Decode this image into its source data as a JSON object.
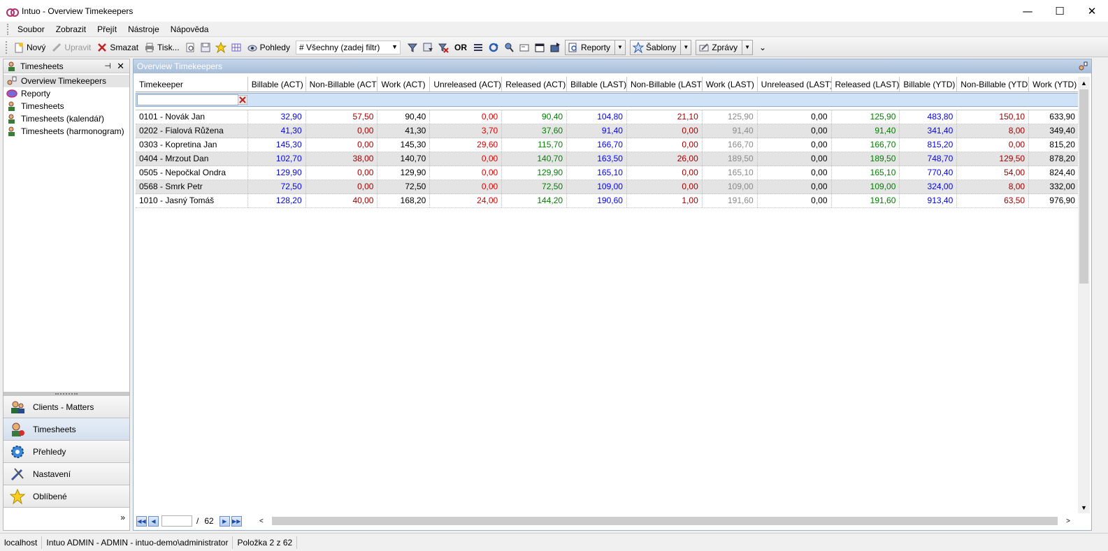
{
  "window": {
    "title": "Intuo - Overview Timekeepers",
    "minimize": "—",
    "maximize": "☐",
    "close": "✕"
  },
  "menu": [
    "Soubor",
    "Zobrazit",
    "Přejít",
    "Nástroje",
    "Nápověda"
  ],
  "toolbar": {
    "new_label": "Nový",
    "edit_label": "Upravit",
    "delete_label": "Smazat",
    "print_label": "Tisk...",
    "views_label": "Pohledy",
    "filter_value": "# Všechny (zadej filtr)",
    "or_label": "OR",
    "reports_label": "Reporty",
    "templates_label": "Šablony",
    "messages_label": "Zprávy",
    "overflow": "⌄"
  },
  "leftpanel": {
    "title": "Timesheets",
    "pin": "📌",
    "close": "✕",
    "tree": [
      {
        "label": "Overview Timekeepers",
        "icon": "timekeepers-icon",
        "selected": true
      },
      {
        "label": "Reporty",
        "icon": "reports-icon",
        "selected": false
      },
      {
        "label": "Timesheets",
        "icon": "person-icon",
        "selected": false
      },
      {
        "label": "Timesheets (kalendář)",
        "icon": "person-icon",
        "selected": false
      },
      {
        "label": "Timesheets (harmonogram)",
        "icon": "person-icon",
        "selected": false
      }
    ],
    "nav": [
      {
        "label": "Clients - Matters",
        "icon": "clients-icon",
        "active": false
      },
      {
        "label": "Timesheets",
        "icon": "timesheets-icon",
        "active": true
      },
      {
        "label": "Přehledy",
        "icon": "overview-gear-icon",
        "active": false
      },
      {
        "label": "Nastavení",
        "icon": "settings-tools-icon",
        "active": false
      },
      {
        "label": "Oblíbené",
        "icon": "star-icon",
        "active": false
      }
    ],
    "more_chevron": "»"
  },
  "main": {
    "title": "Overview Timekeepers",
    "columns": [
      "Timekeeper",
      "Billable (ACT)",
      "Non-Billable (ACT)",
      "Work (ACT)",
      "Unreleased (ACT)",
      "Released (ACT)",
      "Billable (LAST)",
      "Non-Billable (LAST)",
      "Work (LAST)",
      "Unreleased (LAST)",
      "Released (LAST)",
      "Billable (YTD)",
      "Non-Billable (YTD)",
      "Work (YTD)"
    ],
    "column_colors": [
      "black",
      "blue",
      "red",
      "black",
      "bred",
      "green",
      "blue",
      "red",
      "gray",
      "black",
      "green",
      "blue",
      "red",
      "black"
    ],
    "rows": [
      [
        "0101 - Novák Jan",
        "32,90",
        "57,50",
        "90,40",
        "0,00",
        "90,40",
        "104,80",
        "21,10",
        "125,90",
        "0,00",
        "125,90",
        "483,80",
        "150,10",
        "633,90"
      ],
      [
        "0202 - Fialová Růžena",
        "41,30",
        "0,00",
        "41,30",
        "3,70",
        "37,60",
        "91,40",
        "0,00",
        "91,40",
        "0,00",
        "91,40",
        "341,40",
        "8,00",
        "349,40"
      ],
      [
        "0303 - Kopretina Jan",
        "145,30",
        "0,00",
        "145,30",
        "29,60",
        "115,70",
        "166,70",
        "0,00",
        "166,70",
        "0,00",
        "166,70",
        "815,20",
        "0,00",
        "815,20"
      ],
      [
        "0404 - Mrzout Dan",
        "102,70",
        "38,00",
        "140,70",
        "0,00",
        "140,70",
        "163,50",
        "26,00",
        "189,50",
        "0,00",
        "189,50",
        "748,70",
        "129,50",
        "878,20"
      ],
      [
        "0505 - Nepočkal Ondra",
        "129,90",
        "0,00",
        "129,90",
        "0,00",
        "129,90",
        "165,10",
        "0,00",
        "165,10",
        "0,00",
        "165,10",
        "770,40",
        "54,00",
        "824,40"
      ],
      [
        "0568 - Smrk Petr",
        "72,50",
        "0,00",
        "72,50",
        "0,00",
        "72,50",
        "109,00",
        "0,00",
        "109,00",
        "0,00",
        "109,00",
        "324,00",
        "8,00",
        "332,00"
      ],
      [
        "1010 - Jasný Tomáš",
        "128,20",
        "40,00",
        "168,20",
        "24,00",
        "144,20",
        "190,60",
        "1,00",
        "191,60",
        "0,00",
        "191,60",
        "913,40",
        "63,50",
        "976,90"
      ]
    ],
    "pager": {
      "page_value": "",
      "separator": "/",
      "total": "62"
    }
  },
  "status": {
    "server": "localhost",
    "user": "Intuo ADMIN - ADMIN - intuo-demo\\administrator",
    "position": "Položka 2 z 62"
  },
  "colors": {
    "blue": "#0000ff",
    "red": "#a00000",
    "bred": "#e00000",
    "green": "#008000",
    "gray": "#8a8a8a",
    "header_blue": "#a7bdd8"
  }
}
